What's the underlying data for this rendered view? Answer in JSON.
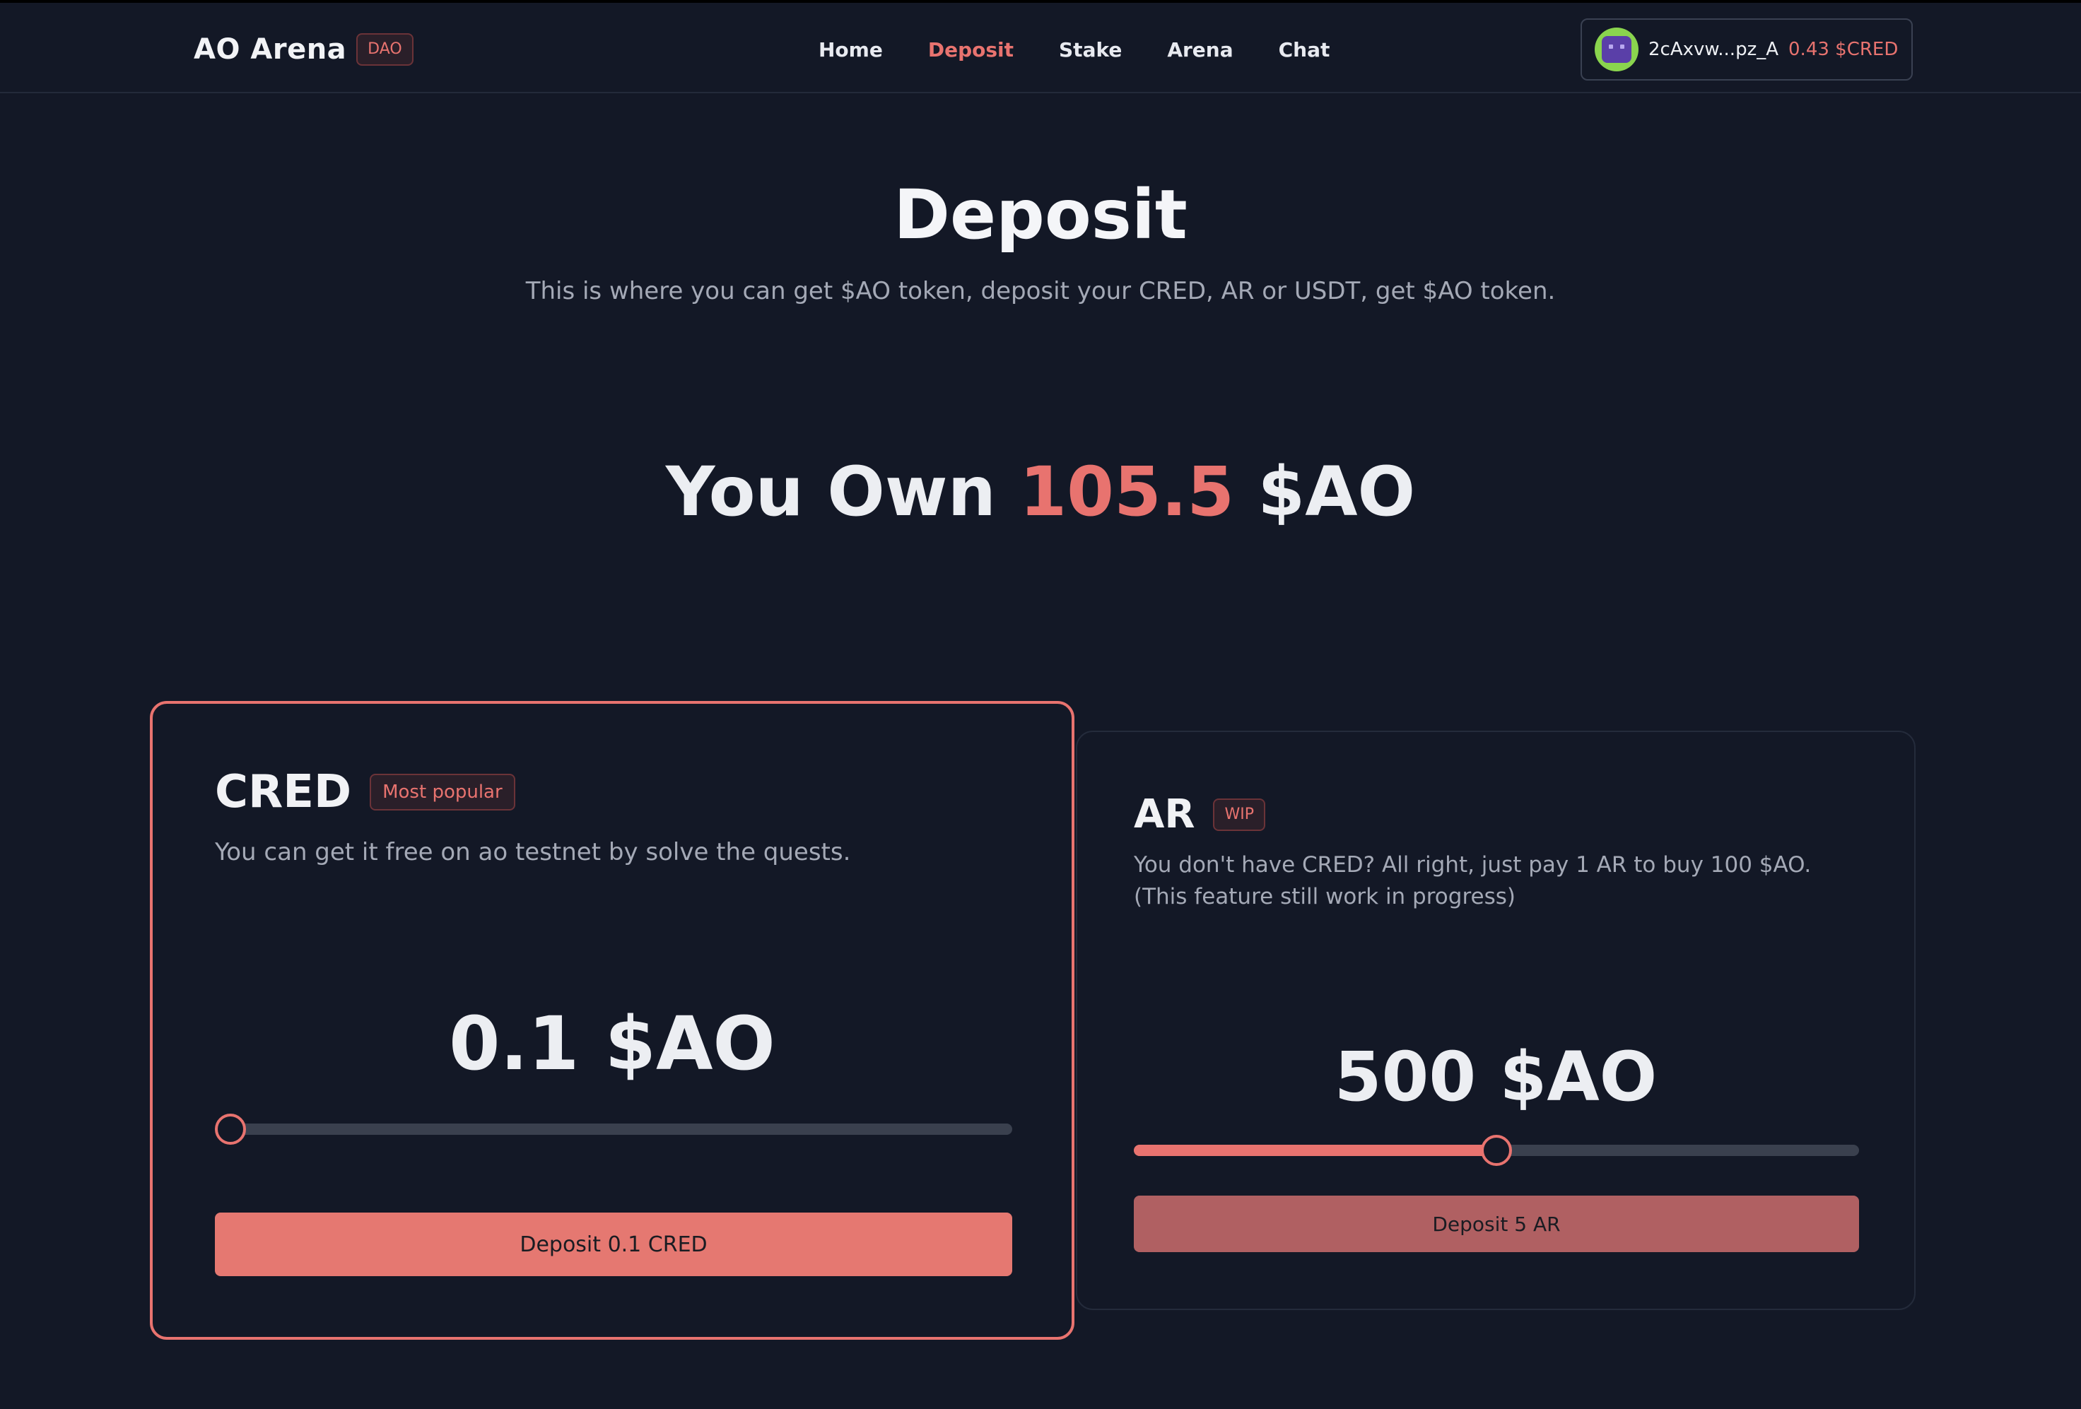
{
  "header": {
    "brand": "AO Arena",
    "brand_badge": "DAO",
    "nav": [
      {
        "label": "Home",
        "active": false
      },
      {
        "label": "Deposit",
        "active": true
      },
      {
        "label": "Stake",
        "active": false
      },
      {
        "label": "Arena",
        "active": false
      },
      {
        "label": "Chat",
        "active": false
      }
    ],
    "wallet": {
      "address": "2cAxvw...pz_A",
      "balance": "0.43 $CRED"
    }
  },
  "hero": {
    "title": "Deposit",
    "subtitle": "This is where you can get $AO token, deposit your CRED, AR or USDT, get $AO token.",
    "own_prefix": "You Own",
    "own_amount": "105.5",
    "own_unit": "$AO"
  },
  "cards": [
    {
      "title": "CRED",
      "badge": "Most popular",
      "description": "You can get it free on ao testnet by solve the quests.",
      "amount": "0.1 $AO",
      "slider_value_fraction": 0.0,
      "button": "Deposit 0.1 CRED"
    },
    {
      "title": "AR",
      "badge": "WIP",
      "description": "You don't have CRED? All right, just pay 1 AR to buy 100 $AO. (This feature still work in progress)",
      "amount": "500 $AO",
      "slider_value_fraction": 0.5,
      "button": "Deposit 5 AR"
    }
  ],
  "colors": {
    "background": "#131826",
    "accent": "#e8736f",
    "muted_text": "#a4a9b6"
  }
}
